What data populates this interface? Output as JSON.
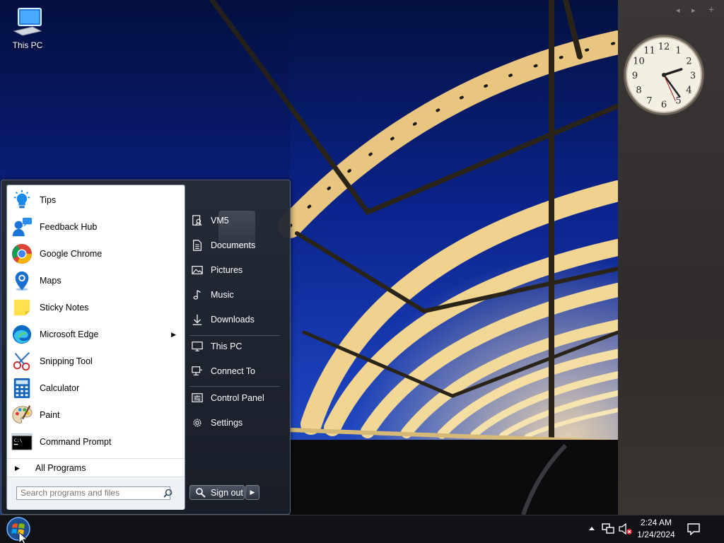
{
  "desktop": {
    "icons": [
      {
        "label": "This PC",
        "icon": "computer-icon"
      }
    ]
  },
  "gadgets": {
    "prev": "◂",
    "next": "▸",
    "add": "+",
    "clock": {
      "hour": 2,
      "minute": 24,
      "second": 26,
      "numerals": [
        "12",
        "1",
        "2",
        "3",
        "4",
        "5",
        "6",
        "7",
        "8",
        "9",
        "10",
        "11"
      ]
    }
  },
  "start_menu": {
    "programs": [
      {
        "label": "Tips",
        "icon": "lightbulb-icon"
      },
      {
        "label": "Feedback Hub",
        "icon": "feedback-icon"
      },
      {
        "label": "Google Chrome",
        "icon": "chrome-icon"
      },
      {
        "label": "Maps",
        "icon": "map-pin-icon"
      },
      {
        "label": "Sticky Notes",
        "icon": "sticky-note-icon"
      },
      {
        "label": "Microsoft Edge",
        "icon": "edge-icon",
        "has_submenu": true
      },
      {
        "label": "Snipping Tool",
        "icon": "scissors-icon"
      },
      {
        "label": "Calculator",
        "icon": "calculator-icon"
      },
      {
        "label": "Paint",
        "icon": "palette-icon"
      },
      {
        "label": "Command Prompt",
        "icon": "terminal-icon"
      }
    ],
    "all_programs": "All Programs",
    "search_placeholder": "Search programs and files",
    "right_items": [
      {
        "label": "VM5",
        "icon": "user-folder-icon"
      },
      {
        "label": "Documents",
        "icon": "document-icon"
      },
      {
        "label": "Pictures",
        "icon": "picture-icon"
      },
      {
        "label": "Music",
        "icon": "music-note-icon"
      },
      {
        "label": "Downloads",
        "icon": "download-icon"
      },
      {
        "label": "This PC",
        "icon": "monitor-icon"
      },
      {
        "label": "Connect To",
        "icon": "connect-icon"
      },
      {
        "label": "Control Panel",
        "icon": "control-panel-icon"
      },
      {
        "label": "Settings",
        "icon": "gear-icon"
      }
    ],
    "sign_out": "Sign out"
  },
  "taskbar": {
    "time": "2:24 AM",
    "date": "1/24/2024",
    "tray_icons": [
      "chevron-up-icon",
      "network-icon",
      "volume-muted-icon",
      "notification-icon"
    ]
  },
  "colors": {
    "accent": "#0a1f6e",
    "taskbar": "#101216",
    "menu_bg": "#262c34"
  }
}
